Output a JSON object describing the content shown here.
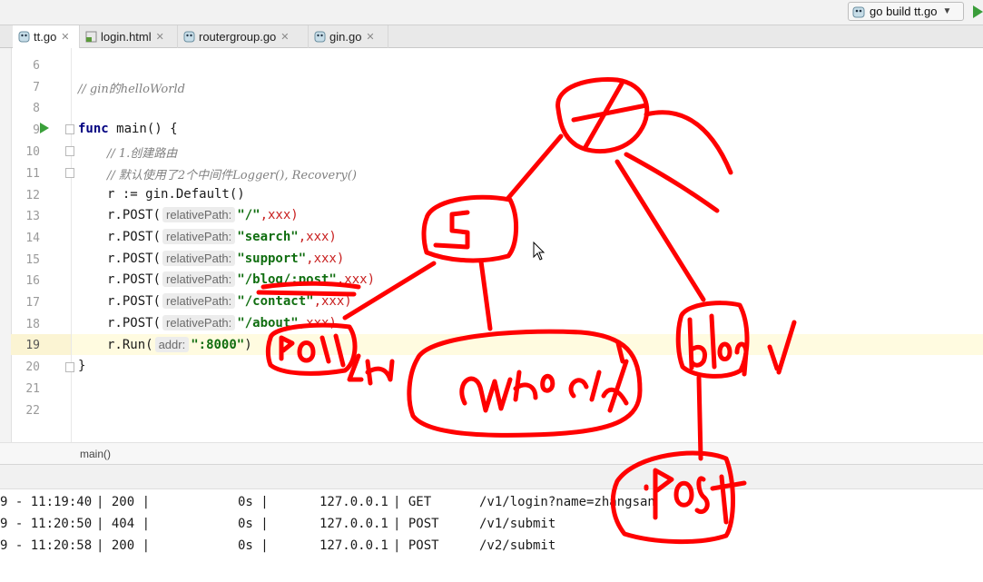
{
  "toolbar": {
    "run_config_label": "go build tt.go",
    "run_config_icon": "gopher-icon",
    "run_icon": "run-triangle-icon"
  },
  "tabs": [
    {
      "label": "tt.go",
      "icon": "gopher-icon",
      "active": true
    },
    {
      "label": "login.html",
      "icon": "html-file-icon",
      "active": false
    },
    {
      "label": "routergroup.go",
      "icon": "gopher-icon",
      "active": false
    },
    {
      "label": "gin.go",
      "icon": "gopher-icon",
      "active": false
    }
  ],
  "editor": {
    "line_numbers": [
      "6",
      "7",
      "8",
      "9",
      "10",
      "11",
      "12",
      "13",
      "14",
      "15",
      "16",
      "17",
      "18",
      "19",
      "20",
      "21",
      "22"
    ],
    "current_line": "19",
    "lines": {
      "c7": "// gin的helloWorld",
      "func_kw": "func",
      "func_sig": " main() {",
      "c10": "// 1.创建路由",
      "c11": "// 默认使用了2个中间件Logger(), Recovery()",
      "l12": "r := gin.Default()",
      "post": "r.POST(",
      "hint_relpath": "relativePath:",
      "routes": [
        "\"/\"",
        "\"search\"",
        "\"support\"",
        "\"/blog/:post\"",
        "\"/contact\"",
        "\"/about\""
      ],
      "handler": ",xxx)",
      "run_prefix": "r.Run(",
      "hint_addr": "addr:",
      "run_arg": "\":8000\"",
      "run_suffix": ")",
      "close_brace": "}"
    }
  },
  "breadcrumb": "main()",
  "console": {
    "rows": [
      {
        "date": "9 - 11:19:40",
        "status": "| 200 |",
        "latency": "0s |",
        "ip": "127.0.0.1",
        "method": "| GET",
        "path": "/v1/login?name=zhangsan"
      },
      {
        "date": "9 - 11:20:50",
        "status": "| 404 |",
        "latency": "0s |",
        "ip": "127.0.0.1",
        "method": "| POST",
        "path": "/v1/submit"
      },
      {
        "date": "9 - 11:20:58",
        "status": "| 200 |",
        "latency": "0s |",
        "ip": "127.0.0.1",
        "method": "| POST",
        "path": "/v2/submit"
      }
    ]
  },
  "annotation": {
    "ink_color": "#ff0000",
    "handwritten_words": [
      "post",
      "ch",
      "search support",
      "blog",
      "post"
    ]
  },
  "colors": {
    "current_line_bg": "#fffbe0",
    "keyword": "#000080",
    "string": "#106e10",
    "handler": "#c81e1e",
    "comment": "#808080"
  }
}
